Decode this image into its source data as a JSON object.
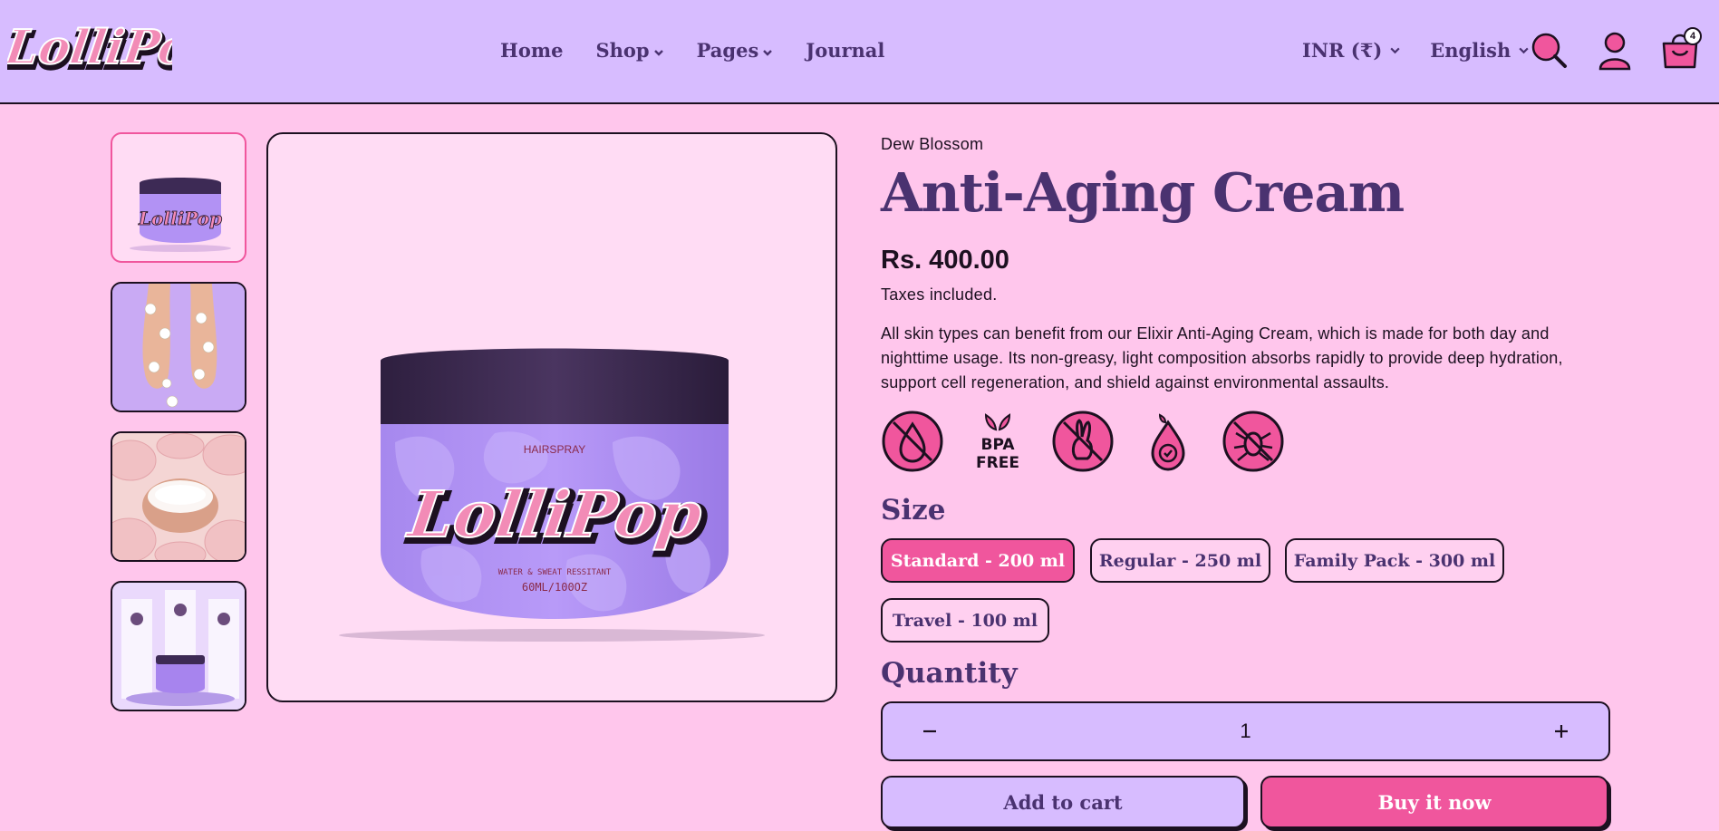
{
  "header": {
    "logo_text": "LolliPop",
    "nav": [
      {
        "label": "Home",
        "has_dropdown": false
      },
      {
        "label": "Shop",
        "has_dropdown": true
      },
      {
        "label": "Pages",
        "has_dropdown": true
      },
      {
        "label": "Journal",
        "has_dropdown": false
      }
    ],
    "currency": "INR (₹)",
    "language": "English",
    "cart_count": "4",
    "icons": [
      "search-icon",
      "account-icon",
      "cart-icon"
    ]
  },
  "gallery": {
    "thumbnails": [
      "cream-jar-front",
      "feet-with-flowers",
      "cream-in-roses",
      "product-lineup"
    ],
    "main_image": {
      "label": "HAIRSPRAY",
      "brand": "LolliPop",
      "tagline": "WATER & SWEAT RESSITANT",
      "volume": "60ML/100OZ"
    }
  },
  "product": {
    "vendor": "Dew Blossom",
    "title": "Anti-Aging Cream",
    "price": "Rs. 400.00",
    "tax_note": "Taxes included.",
    "description": "All skin types can benefit from our Elixir Anti-Aging Cream, which is made for both day and nighttime usage. Its non-greasy, light composition absorbs rapidly to provide deep hydration, support cell regeneration, and shield against environmental assaults.",
    "badges": [
      "no-water-icon",
      "bpa-free-icon",
      "cruelty-free-icon",
      "organic-drop-icon",
      "no-bugs-icon"
    ],
    "bpa_text": [
      "BPA",
      "FREE"
    ],
    "size_label": "Size",
    "sizes": [
      {
        "label": "Standard - 200 ml",
        "selected": true
      },
      {
        "label": "Regular - 250 ml",
        "selected": false
      },
      {
        "label": "Family Pack - 300 ml",
        "selected": false
      },
      {
        "label": "Travel - 100 ml",
        "selected": false
      }
    ],
    "quantity_label": "Quantity",
    "quantity": "1",
    "add_to_cart": "Add to cart",
    "buy_now": "Buy it now"
  },
  "colors": {
    "background": "#ffc6ec",
    "header": "#d7bcff",
    "accent_pink": "#f0569d",
    "purple_text": "#4a3270"
  }
}
